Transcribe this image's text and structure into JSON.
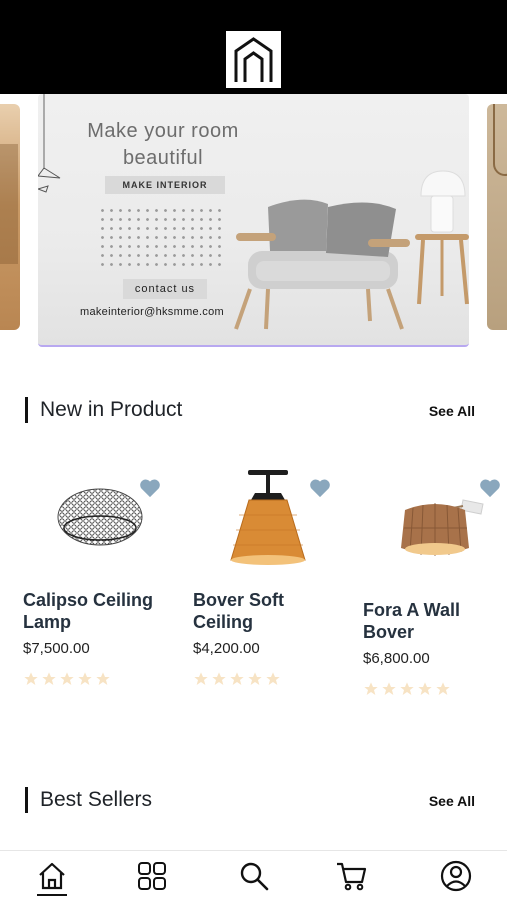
{
  "app": {
    "logo_icon": "house-arch-logo-icon"
  },
  "banner": {
    "title_line1": "Make your room",
    "title_line2": "beautiful",
    "tag": "MAKE INTERIOR",
    "contact_label": "contact us",
    "email": "makeinterior@hksmme.com"
  },
  "new_products": {
    "title": "New in Product",
    "see_all": "See All",
    "items": [
      {
        "name": "Calipso Ceiling Lamp",
        "price": "$7,500.00",
        "rating": 0,
        "max_rating": 5
      },
      {
        "name": "Bover Soft Ceiling",
        "price": "$4,200.00",
        "rating": 0,
        "max_rating": 5
      },
      {
        "name": "Fora A Wall Bover",
        "price": "$6,800.00",
        "rating": 0,
        "max_rating": 5
      }
    ]
  },
  "best_sellers": {
    "title": "Best Sellers",
    "see_all": "See All"
  },
  "tabbar": {
    "items": [
      {
        "icon": "home-icon",
        "active": true
      },
      {
        "icon": "grid-icon",
        "active": false
      },
      {
        "icon": "search-icon",
        "active": false
      },
      {
        "icon": "cart-icon",
        "active": false
      },
      {
        "icon": "profile-icon",
        "active": false
      }
    ]
  },
  "colors": {
    "heart": "#8aa7bd",
    "star": "#f7e3c4",
    "accent_line": "#b8a8f0"
  }
}
